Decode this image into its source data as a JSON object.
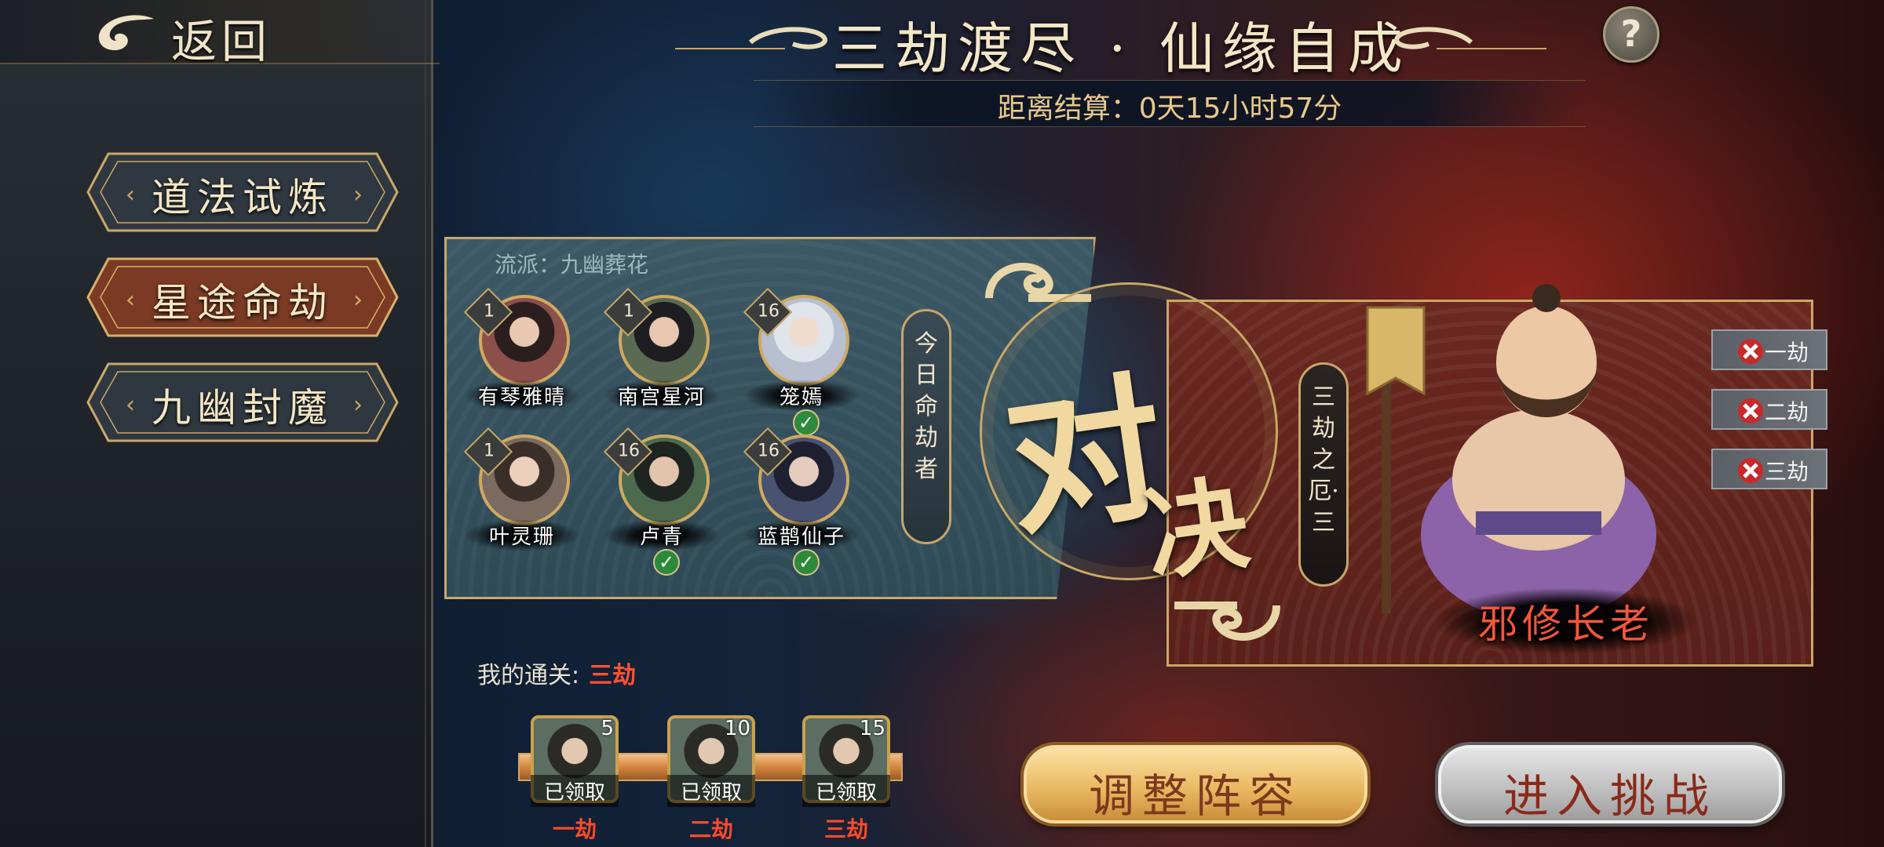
{
  "header": {
    "back_label": "返回",
    "title": "三劫渡尽 · 仙缘自成",
    "countdown": "距离结算：0天15小时57分",
    "help_label": "?"
  },
  "sidebar": {
    "items": [
      {
        "label": "道法试炼",
        "active": false
      },
      {
        "label": "星途命劫",
        "active": true
      },
      {
        "label": "九幽封魔",
        "active": false
      }
    ]
  },
  "team": {
    "faction": "流派：九幽葬花",
    "destiny_label": "今日命劫者",
    "heroes": [
      {
        "name": "有琴雅晴",
        "level": "1",
        "checked": false,
        "color": "#8d4f4a"
      },
      {
        "name": "南宫星河",
        "level": "1",
        "checked": false,
        "color": "#5b6a52"
      },
      {
        "name": "笼嫣",
        "level": "16",
        "checked": true,
        "color": "#b7bfd0"
      },
      {
        "name": "叶灵珊",
        "level": "1",
        "checked": false,
        "color": "#7a6a60"
      },
      {
        "name": "卢青",
        "level": "16",
        "checked": true,
        "color": "#4d6a4e"
      },
      {
        "name": "蓝鹊仙子",
        "level": "16",
        "checked": true,
        "color": "#4a5272"
      }
    ]
  },
  "duel": {
    "char1": "对",
    "char2": "决"
  },
  "enemy": {
    "stage_label": "三劫之厄·三",
    "name": "邪修长老",
    "tiers": [
      "一劫",
      "二劫",
      "三劫"
    ]
  },
  "progress": {
    "label": "我的通关:",
    "value": "三劫",
    "rewards": [
      {
        "count": "5",
        "status": "已领取",
        "tier": "一劫"
      },
      {
        "count": "10",
        "status": "已领取",
        "tier": "二劫"
      },
      {
        "count": "15",
        "status": "已领取",
        "tier": "三劫"
      }
    ]
  },
  "actions": {
    "adjust": "调整阵容",
    "enter": "进入挑战"
  },
  "colors": {
    "accent_gold": "#c9a868",
    "red_text": "#ff4a2a",
    "check_green": "#2c8a3a"
  }
}
